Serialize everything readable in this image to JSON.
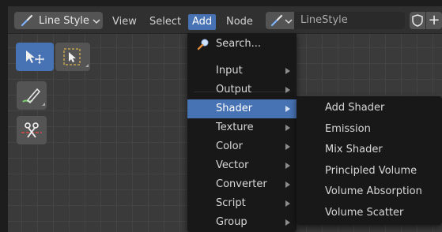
{
  "header": {
    "editor_type_label": "Line Style",
    "menu": [
      "View",
      "Select",
      "Add",
      "Node"
    ],
    "active_menu": "Add",
    "linestyle_name": "LineStyle",
    "new_button": "+"
  },
  "toolbar": {
    "tools": [
      "tweak",
      "select-box",
      "annotate",
      "cut-links"
    ]
  },
  "add_menu": {
    "search_label": "Search...",
    "items": [
      {
        "label": "Input"
      },
      {
        "label": "Output"
      },
      {
        "label": "Shader"
      },
      {
        "label": "Texture"
      },
      {
        "label": "Color"
      },
      {
        "label": "Vector"
      },
      {
        "label": "Converter"
      },
      {
        "label": "Script"
      },
      {
        "label": "Group"
      }
    ],
    "highlighted": "Shader"
  },
  "shader_submenu": {
    "items": [
      {
        "label": "Add Shader"
      },
      {
        "label": "Emission"
      },
      {
        "label": "Mix Shader"
      },
      {
        "label": "Principled Volume"
      },
      {
        "label": "Volume Absorption"
      },
      {
        "label": "Volume Scatter"
      }
    ]
  },
  "colors": {
    "accent": "#4772b3",
    "menu_bg": "#181818",
    "header_bg": "#303030",
    "canvas_bg": "#3a3a3a"
  }
}
